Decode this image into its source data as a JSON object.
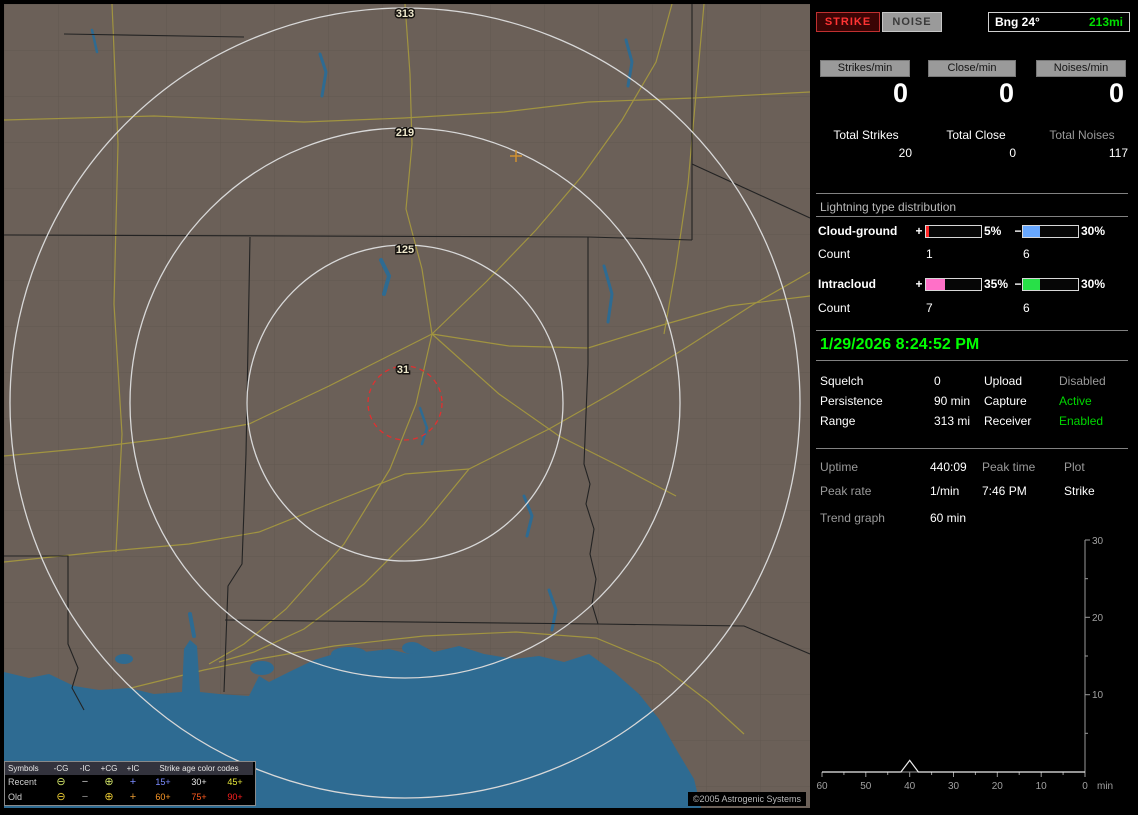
{
  "map": {
    "rings": [
      {
        "label": "313"
      },
      {
        "label": "219"
      },
      {
        "label": "125"
      },
      {
        "label": "31"
      }
    ],
    "copyright": "©2005 Astrogenic Systems",
    "colors": {
      "land": "#6b6058",
      "water": "#2e6b92",
      "road": "#a79a3e",
      "state_line": "#232323",
      "ring": "#d8d8d8",
      "close_ring": "#e03030",
      "strike_cross": "#d09030"
    },
    "legend": {
      "header": {
        "symbols": "Symbols",
        "cols": [
          "-CG",
          "-IC",
          "+CG",
          "+IC"
        ],
        "age": "Strike age color codes"
      },
      "rows": [
        {
          "label": "Recent",
          "symbols": [
            {
              "glyph": "⊖",
              "color": "#cde066"
            },
            {
              "glyph": "−",
              "color": "#c0c0c0"
            },
            {
              "glyph": "⊕",
              "color": "#cde066"
            },
            {
              "glyph": "+",
              "color": "#7b8cff"
            }
          ],
          "ages": [
            {
              "text": "15+",
              "color": "#7b8cff"
            },
            {
              "text": "30+",
              "color": "#e8e8e8"
            },
            {
              "text": "45+",
              "color": "#e8e83a"
            }
          ]
        },
        {
          "label": "Old",
          "symbols": [
            {
              "glyph": "⊖",
              "color": "#e8c832"
            },
            {
              "glyph": "−",
              "color": "#9a9a9a"
            },
            {
              "glyph": "⊕",
              "color": "#e8c832"
            },
            {
              "glyph": "+",
              "color": "#e89a32"
            }
          ],
          "ages": [
            {
              "text": "60+",
              "color": "#ff9a28"
            },
            {
              "text": "75+",
              "color": "#ff5a1e"
            },
            {
              "text": "90+",
              "color": "#ff2020"
            }
          ]
        }
      ]
    }
  },
  "panel": {
    "indicators": {
      "strike": "STRIKE",
      "noise": "NOISE",
      "bearing": "Bng 24°",
      "bearing_distance": "213mi",
      "bearing_distance_color": "#00e000"
    },
    "rates": [
      {
        "label": "Strikes/min",
        "value": "0"
      },
      {
        "label": "Close/min",
        "value": "0"
      },
      {
        "label": "Noises/min",
        "value": "0"
      }
    ],
    "totals": [
      {
        "label": "Total Strikes",
        "value": "20"
      },
      {
        "label": "Total Close",
        "value": "0"
      },
      {
        "label": "Total Noises",
        "value": "117"
      }
    ],
    "distribution": {
      "title": "Lightning type distribution",
      "count_label": "Count",
      "rows": [
        {
          "name": "Cloud-ground",
          "plus_sign": "+",
          "minus_sign": "−",
          "pos_pct": "5%",
          "neg_pct": "30%",
          "pos_count": "1",
          "neg_count": "6",
          "pos_color": "#ff2828",
          "neg_color": "#68a8ff"
        },
        {
          "name": "Intracloud",
          "plus_sign": "+",
          "minus_sign": "−",
          "pos_pct": "35%",
          "neg_pct": "30%",
          "pos_count": "7",
          "neg_count": "6",
          "pos_color": "#ff70c8",
          "neg_color": "#28e048"
        }
      ]
    },
    "datetime": {
      "text": "1/29/2026 8:24:52 PM",
      "color": "#00ff00"
    },
    "settings": [
      {
        "label": "Squelch",
        "value": "0",
        "label2": "Upload",
        "value2": "Disabled",
        "value2_color": "#9a9a9a"
      },
      {
        "label": "Persistence",
        "value": "90 min",
        "label2": "Capture",
        "value2": "Active",
        "value2_color": "#00d800"
      },
      {
        "label": "Range",
        "value": "313 mi",
        "label2": "Receiver",
        "value2": "Enabled",
        "value2_color": "#00d800"
      }
    ],
    "stats": {
      "uptime_label": "Uptime",
      "uptime": "440:09",
      "peaktime_label": "Peak time",
      "plot_label": "Plot",
      "peakrate_label": "Peak rate",
      "peakrate": "1/min",
      "peaktime": "7:46 PM",
      "plot": "Strike"
    },
    "trend": {
      "label": "Trend graph",
      "window": "60 min"
    }
  },
  "chart_data": {
    "type": "line",
    "title": "Trend graph",
    "window": "60 min",
    "x_label": "min",
    "x_ticks": [
      "60",
      "50",
      "40",
      "30",
      "20",
      "10",
      "0"
    ],
    "y_ticks": [
      "30",
      "20",
      "10"
    ],
    "ylim": [
      0,
      30
    ],
    "x_range_minutes_ago": [
      60,
      0
    ],
    "series": [
      {
        "name": "Strike",
        "points": [
          {
            "x": 60,
            "y": 0
          },
          {
            "x": 42,
            "y": 0
          },
          {
            "x": 40,
            "y": 1.5
          },
          {
            "x": 38,
            "y": 0
          },
          {
            "x": 0,
            "y": 0
          }
        ]
      }
    ]
  }
}
